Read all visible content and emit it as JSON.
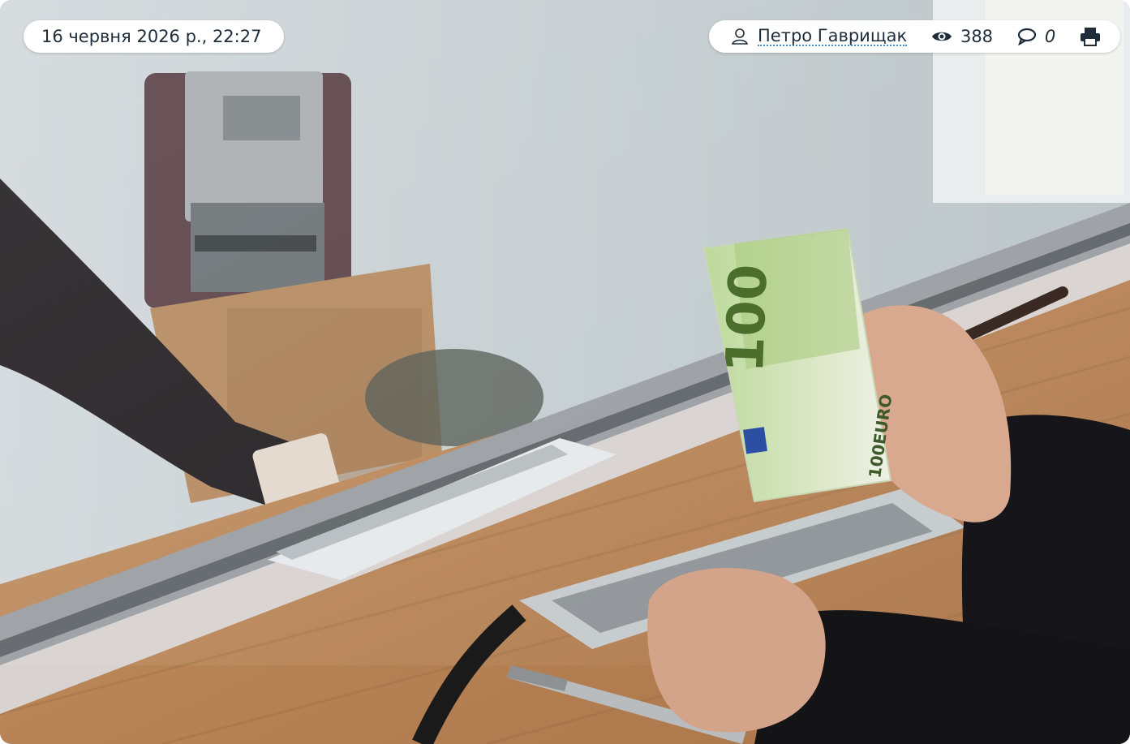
{
  "header": {
    "date": "16 червня 2026 р., 22:27",
    "author": "Петро Гаврищак",
    "views": "388",
    "comments": "0"
  },
  "icons": {
    "author": "user-icon",
    "views": "eye-icon",
    "comments": "comment-icon",
    "print": "print-icon"
  },
  "image": {
    "banknote_value": "100",
    "banknote_text": "100EURO"
  },
  "colors": {
    "pill_bg": "#ffffff",
    "text": "#1f2d3a",
    "link_underline": "#3b8fd6"
  }
}
